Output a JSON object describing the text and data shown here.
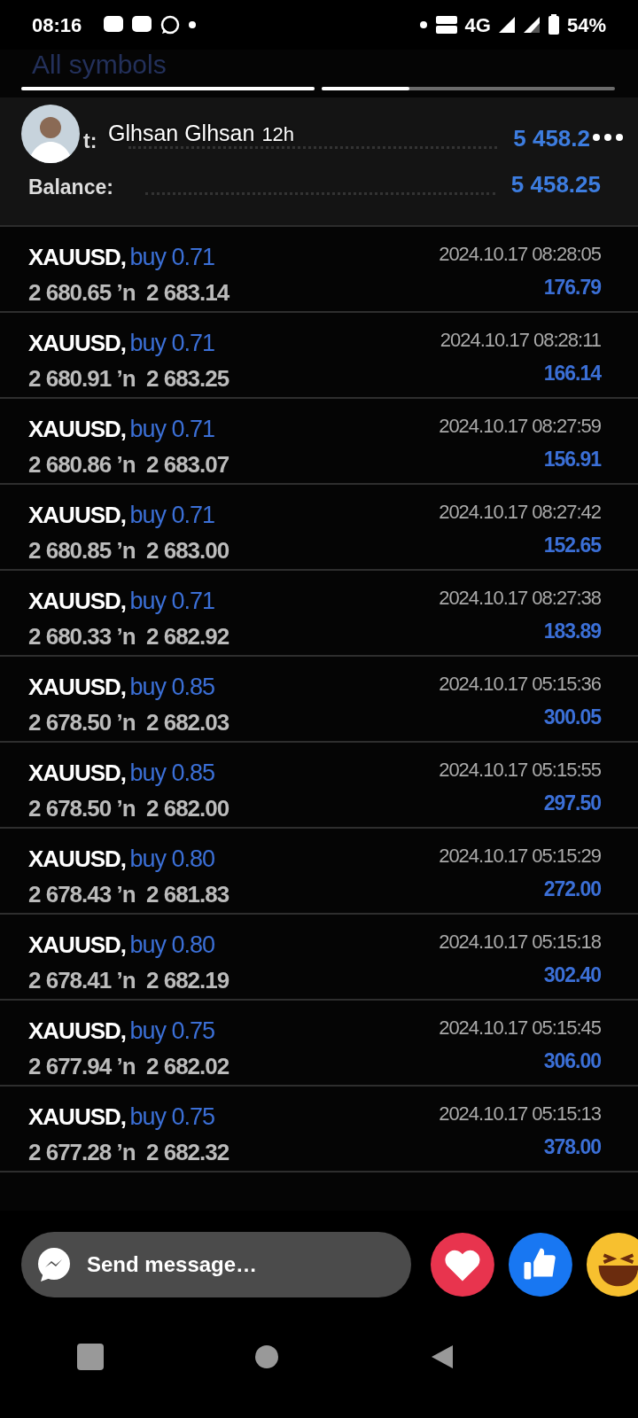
{
  "status_bar": {
    "time": "08:16",
    "network": "4G",
    "battery": "54%"
  },
  "story": {
    "progress": [
      {
        "level": 1
      },
      {
        "level": 0.3
      }
    ],
    "author": "Glhsan Glhsan",
    "age": "12h"
  },
  "screenshot": {
    "tab_label": "All symbols",
    "summary": [
      {
        "label": "t:",
        "value": "5 458.2"
      },
      {
        "label": "Balance:",
        "value": "5 458.25"
      }
    ],
    "trades": [
      {
        "symbol": "XAUUSD,",
        "side": "buy 0.71",
        "prices": "2 680.65 ’n  2 683.14",
        "time": "2024.10.17 08:28:05",
        "profit": "176.79"
      },
      {
        "symbol": "XAUUSD,",
        "side": "buy 0.71",
        "prices": "2 680.91 ’n  2 683.25",
        "time": "2024.10.17 08:28:11",
        "profit": "166.14"
      },
      {
        "symbol": "XAUUSD,",
        "side": "buy 0.71",
        "prices": "2 680.86 ’n  2 683.07",
        "time": "2024.10.17 08:27:59",
        "profit": "156.91"
      },
      {
        "symbol": "XAUUSD,",
        "side": "buy 0.71",
        "prices": "2 680.85 ’n  2 683.00",
        "time": "2024.10.17 08:27:42",
        "profit": "152.65"
      },
      {
        "symbol": "XAUUSD,",
        "side": "buy 0.71",
        "prices": "2 680.33 ’n  2 682.92",
        "time": "2024.10.17 08:27:38",
        "profit": "183.89"
      },
      {
        "symbol": "XAUUSD,",
        "side": "buy 0.85",
        "prices": "2 678.50 ’n  2 682.03",
        "time": "2024.10.17 05:15:36",
        "profit": "300.05"
      },
      {
        "symbol": "XAUUSD,",
        "side": "buy 0.85",
        "prices": "2 678.50 ’n  2 682.00",
        "time": "2024.10.17 05:15:55",
        "profit": "297.50"
      },
      {
        "symbol": "XAUUSD,",
        "side": "buy 0.80",
        "prices": "2 678.43 ’n  2 681.83",
        "time": "2024.10.17 05:15:29",
        "profit": "272.00"
      },
      {
        "symbol": "XAUUSD,",
        "side": "buy 0.80",
        "prices": "2 678.41 ’n  2 682.19",
        "time": "2024.10.17 05:15:18",
        "profit": "302.40"
      },
      {
        "symbol": "XAUUSD,",
        "side": "buy 0.75",
        "prices": "2 677.94 ’n  2 682.02",
        "time": "2024.10.17 05:15:45",
        "profit": "306.00"
      },
      {
        "symbol": "XAUUSD,",
        "side": "buy 0.75",
        "prices": "2 677.28 ’n  2 682.32",
        "time": "2024.10.17 05:15:13",
        "profit": "378.00"
      }
    ]
  },
  "reply": {
    "placeholder": "Send message…"
  }
}
